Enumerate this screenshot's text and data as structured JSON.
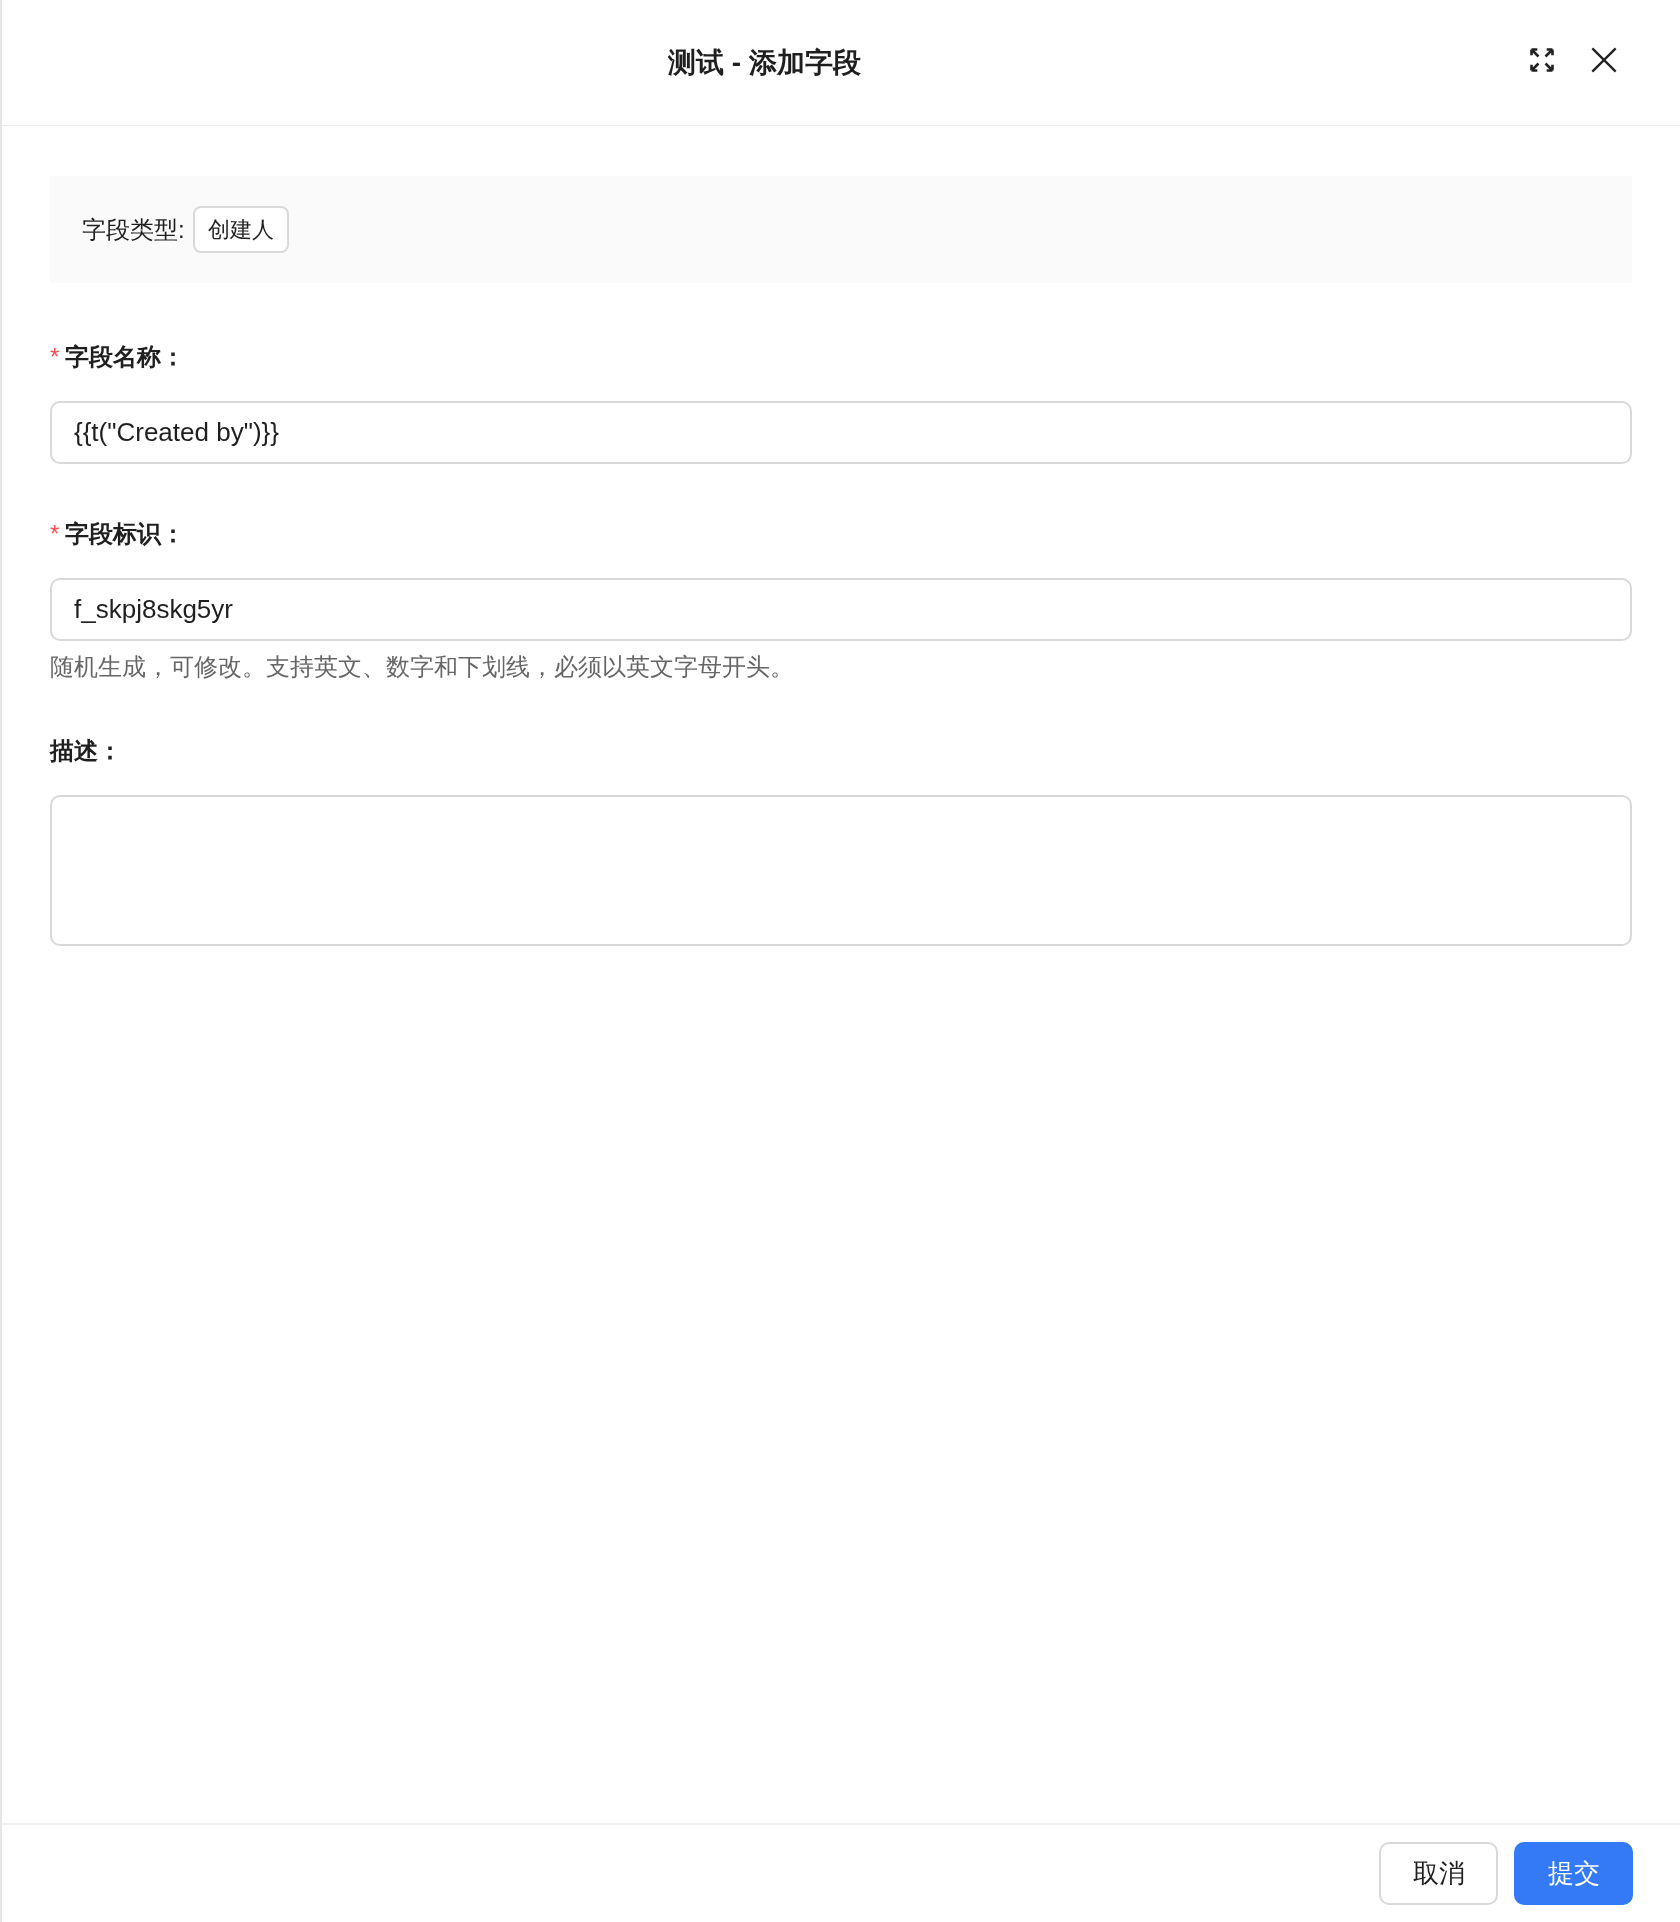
{
  "dialog": {
    "title": "测试 - 添加字段"
  },
  "field_type": {
    "label": "字段类型:",
    "value": "创建人"
  },
  "fields": [
    {
      "kind": "input",
      "label": "字段名称",
      "required": true,
      "value": "{{t(\"Created by\")}}"
    },
    {
      "kind": "input",
      "label": "字段标识",
      "required": true,
      "value": "f_skpj8skg5yr",
      "help": "随机生成，可修改。支持英文、数字和下划线，必须以英文字母开头。"
    },
    {
      "kind": "textarea",
      "label": "描述",
      "required": false
    }
  ],
  "required_mark": "*",
  "label_suffix": "：",
  "buttons": [
    {
      "label": "取消",
      "primary": false
    },
    {
      "label": "提交",
      "primary": true
    }
  ]
}
